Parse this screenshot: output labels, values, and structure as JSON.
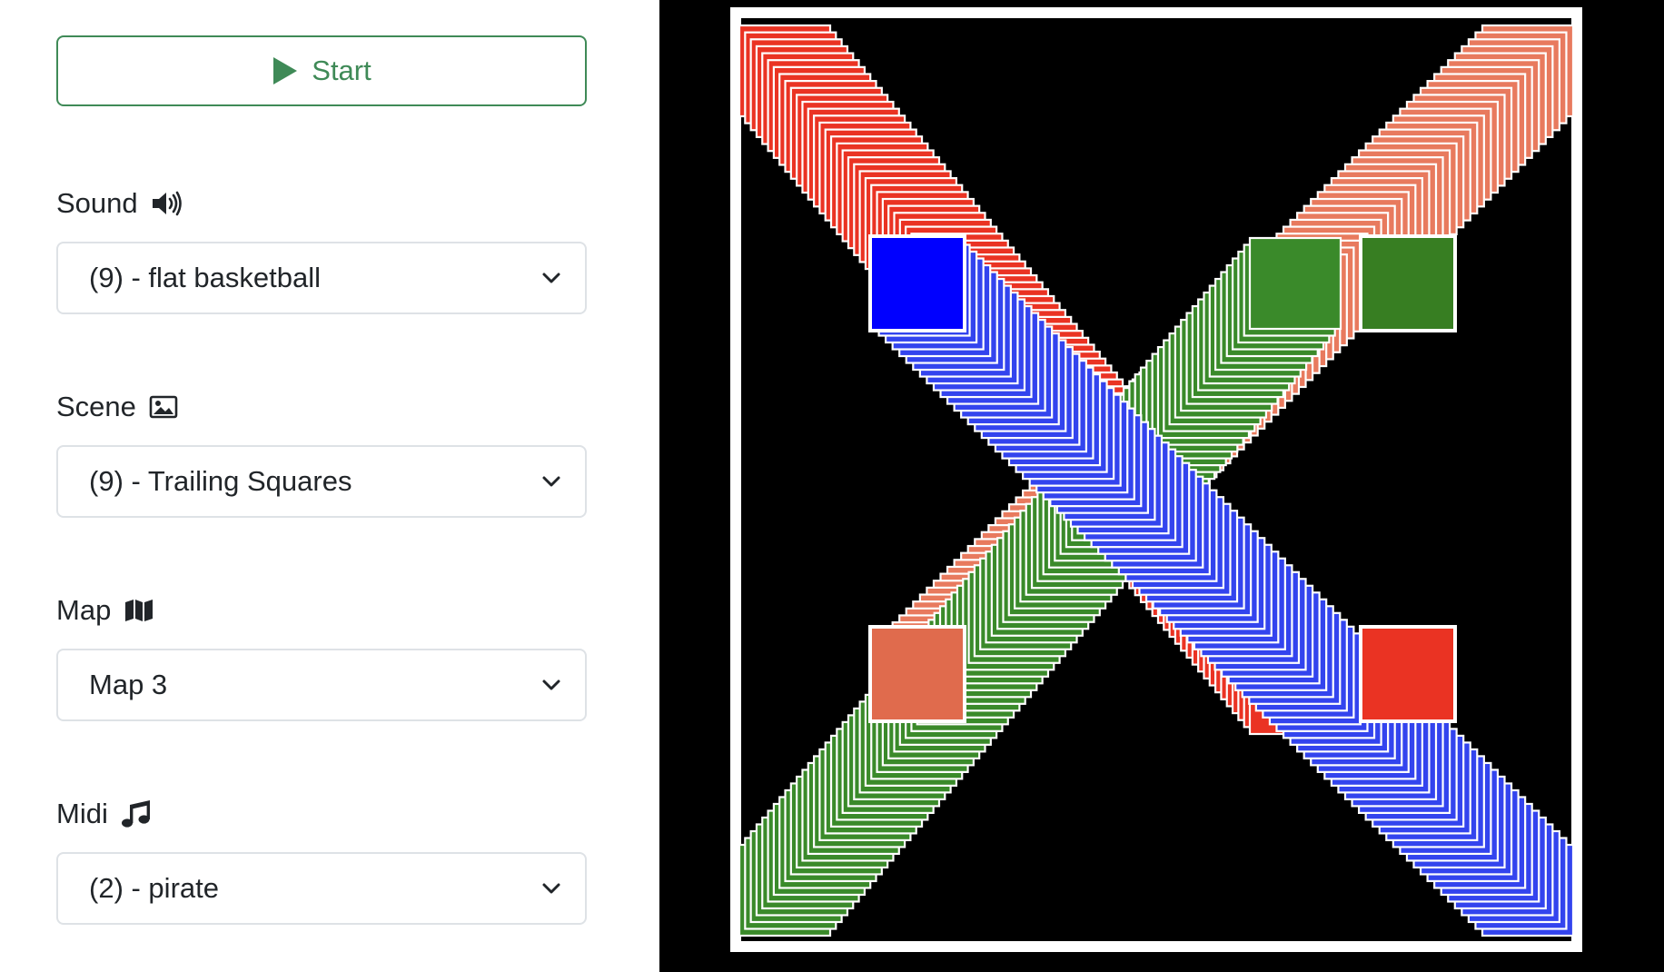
{
  "controls": {
    "start_label": "Start",
    "start_icon": "play-icon",
    "sound": {
      "label": "Sound",
      "icon": "speaker-icon",
      "value": "(9) - flat basketball"
    },
    "scene": {
      "label": "Scene",
      "icon": "image-icon",
      "value": "(9) - Trailing Squares"
    },
    "map": {
      "label": "Map",
      "icon": "map-icon",
      "value": "Map 3"
    },
    "midi": {
      "label": "Midi",
      "icon": "music-note-icon",
      "value": "(2) - pirate"
    }
  },
  "colors": {
    "accent": "#3f8a57",
    "stage_background": "#000000",
    "border": "#ffffff",
    "square_blue": "#0000ff",
    "square_green": "#377e22",
    "square_salmon": "#e06b4d",
    "square_red": "#ea3323",
    "trail_red": "#ea3323",
    "trail_blue": "#3344ee",
    "trail_green": "#3a8a2a",
    "trail_salmon": "#e87a5e"
  },
  "scene": {
    "squares": [
      {
        "name": "blue",
        "color": "#0000ff"
      },
      {
        "name": "green",
        "color": "#377e22"
      },
      {
        "name": "salmon",
        "color": "#e06b4d"
      },
      {
        "name": "red",
        "color": "#ea3323"
      }
    ]
  }
}
